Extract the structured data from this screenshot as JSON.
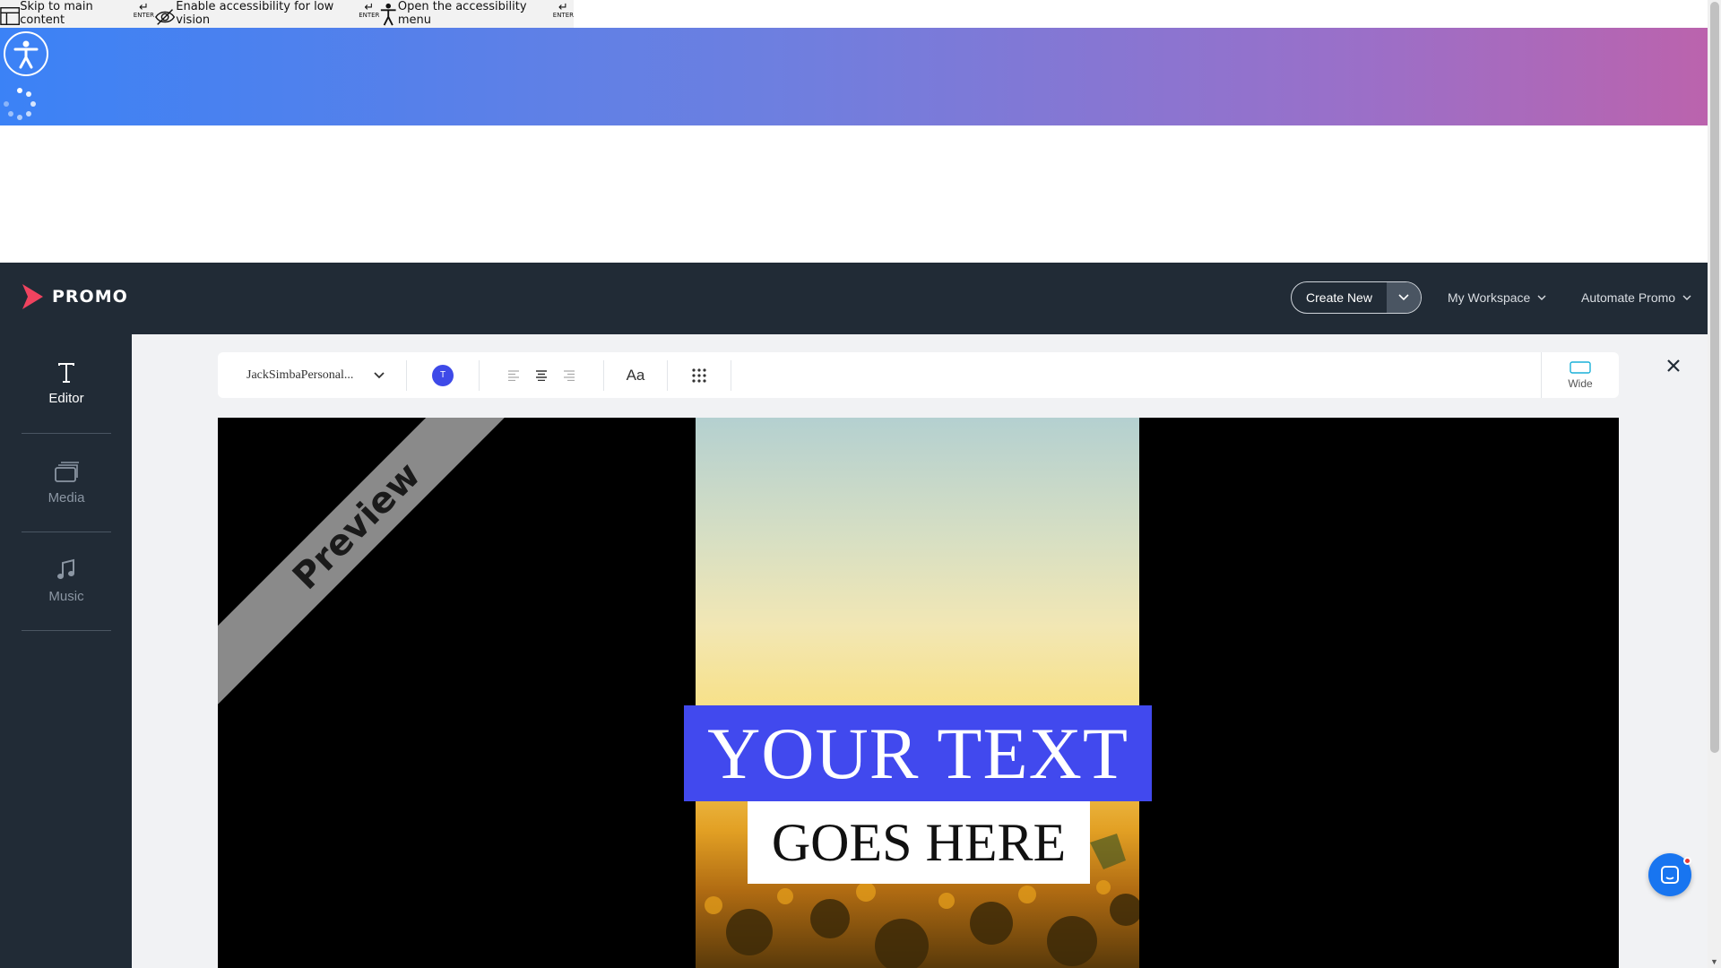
{
  "skip_links": [
    {
      "label": "Skip to main content",
      "key": "ENTER"
    },
    {
      "label": "Enable accessibility for low vision",
      "key": "ENTER"
    },
    {
      "label": "Open the accessibility menu",
      "key": "ENTER"
    }
  ],
  "header": {
    "logo_text": "PROMO",
    "create_new": "Create New",
    "nav": [
      "My Workspace",
      "Automate Promo"
    ]
  },
  "sidebar": {
    "items": [
      {
        "label": "Editor",
        "icon": "text-icon",
        "active": true
      },
      {
        "label": "Media",
        "icon": "media-icon",
        "active": false
      },
      {
        "label": "Music",
        "icon": "music-icon",
        "active": false
      }
    ]
  },
  "toolbar": {
    "font": "JackSimbaPersonal...",
    "color_letter": "T",
    "text_size": "Aa",
    "aspect": "Wide"
  },
  "preview": {
    "watermark": "Preview",
    "line1": "YOUR TEXT",
    "line2": "GOES HERE"
  },
  "colors": {
    "brand": "#f0435f",
    "nav_bg": "#212b36",
    "text_highlight": "#4149ee",
    "chat": "#1875f0"
  }
}
